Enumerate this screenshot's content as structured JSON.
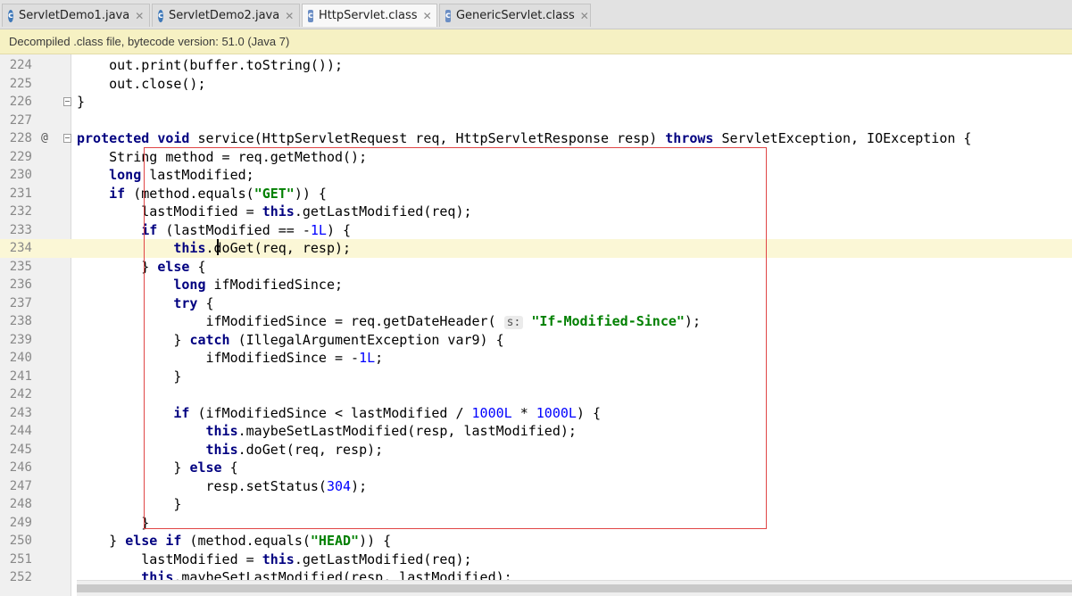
{
  "tabs": [
    {
      "label": "ServletDemo1.java",
      "icon": "java-class-icon",
      "active": false
    },
    {
      "label": "ServletDemo2.java",
      "icon": "java-class-icon",
      "active": false
    },
    {
      "label": "HttpServlet.class",
      "icon": "compiled-class-icon",
      "active": true
    },
    {
      "label": "GenericServlet.class",
      "icon": "compiled-class-icon",
      "active": false
    }
  ],
  "notice": "Decompiled .class file, bytecode version: 51.0 (Java 7)",
  "editor": {
    "current_line": "234",
    "lines": [
      {
        "n": "224",
        "code": "    out.print(buffer.toString());"
      },
      {
        "n": "225",
        "code": "    out.close();"
      },
      {
        "n": "226",
        "code": "}"
      },
      {
        "n": "227",
        "code": ""
      },
      {
        "n": "228",
        "code": "protected void service(HttpServletRequest req, HttpServletResponse resp) throws ServletException, IOException {"
      },
      {
        "n": "229",
        "code": "    String method = req.getMethod();"
      },
      {
        "n": "230",
        "code": "    long lastModified;"
      },
      {
        "n": "231",
        "code": "    if (method.equals(\"GET\")) {"
      },
      {
        "n": "232",
        "code": "        lastModified = this.getLastModified(req);"
      },
      {
        "n": "233",
        "code": "        if (lastModified == -1L) {"
      },
      {
        "n": "234",
        "code": "            this.doGet(req, resp);"
      },
      {
        "n": "235",
        "code": "        } else {"
      },
      {
        "n": "236",
        "code": "            long ifModifiedSince;"
      },
      {
        "n": "237",
        "code": "            try {"
      },
      {
        "n": "238",
        "code": "                ifModifiedSince = req.getDateHeader( s: \"If-Modified-Since\");"
      },
      {
        "n": "239",
        "code": "            } catch (IllegalArgumentException var9) {"
      },
      {
        "n": "240",
        "code": "                ifModifiedSince = -1L;"
      },
      {
        "n": "241",
        "code": "            }"
      },
      {
        "n": "242",
        "code": ""
      },
      {
        "n": "243",
        "code": "            if (ifModifiedSince < lastModified / 1000L * 1000L) {"
      },
      {
        "n": "244",
        "code": "                this.maybeSetLastModified(resp, lastModified);"
      },
      {
        "n": "245",
        "code": "                this.doGet(req, resp);"
      },
      {
        "n": "246",
        "code": "            } else {"
      },
      {
        "n": "247",
        "code": "                resp.setStatus(304);"
      },
      {
        "n": "248",
        "code": "            }"
      },
      {
        "n": "249",
        "code": "        }"
      },
      {
        "n": "250",
        "code": "    } else if (method.equals(\"HEAD\")) {"
      },
      {
        "n": "251",
        "code": "        lastModified = this.getLastModified(req);"
      },
      {
        "n": "252",
        "code": "        this.maybeSetLastModified(resp, lastModified);"
      }
    ]
  },
  "gutter_marks": {
    "228": "@"
  },
  "colors": {
    "keyword": "#000080",
    "string": "#008000",
    "number": "#0000ff",
    "highlight_box": "#e04545",
    "current_line_bg": "#fbf7d6",
    "notice_bg": "#f6f1c3"
  }
}
